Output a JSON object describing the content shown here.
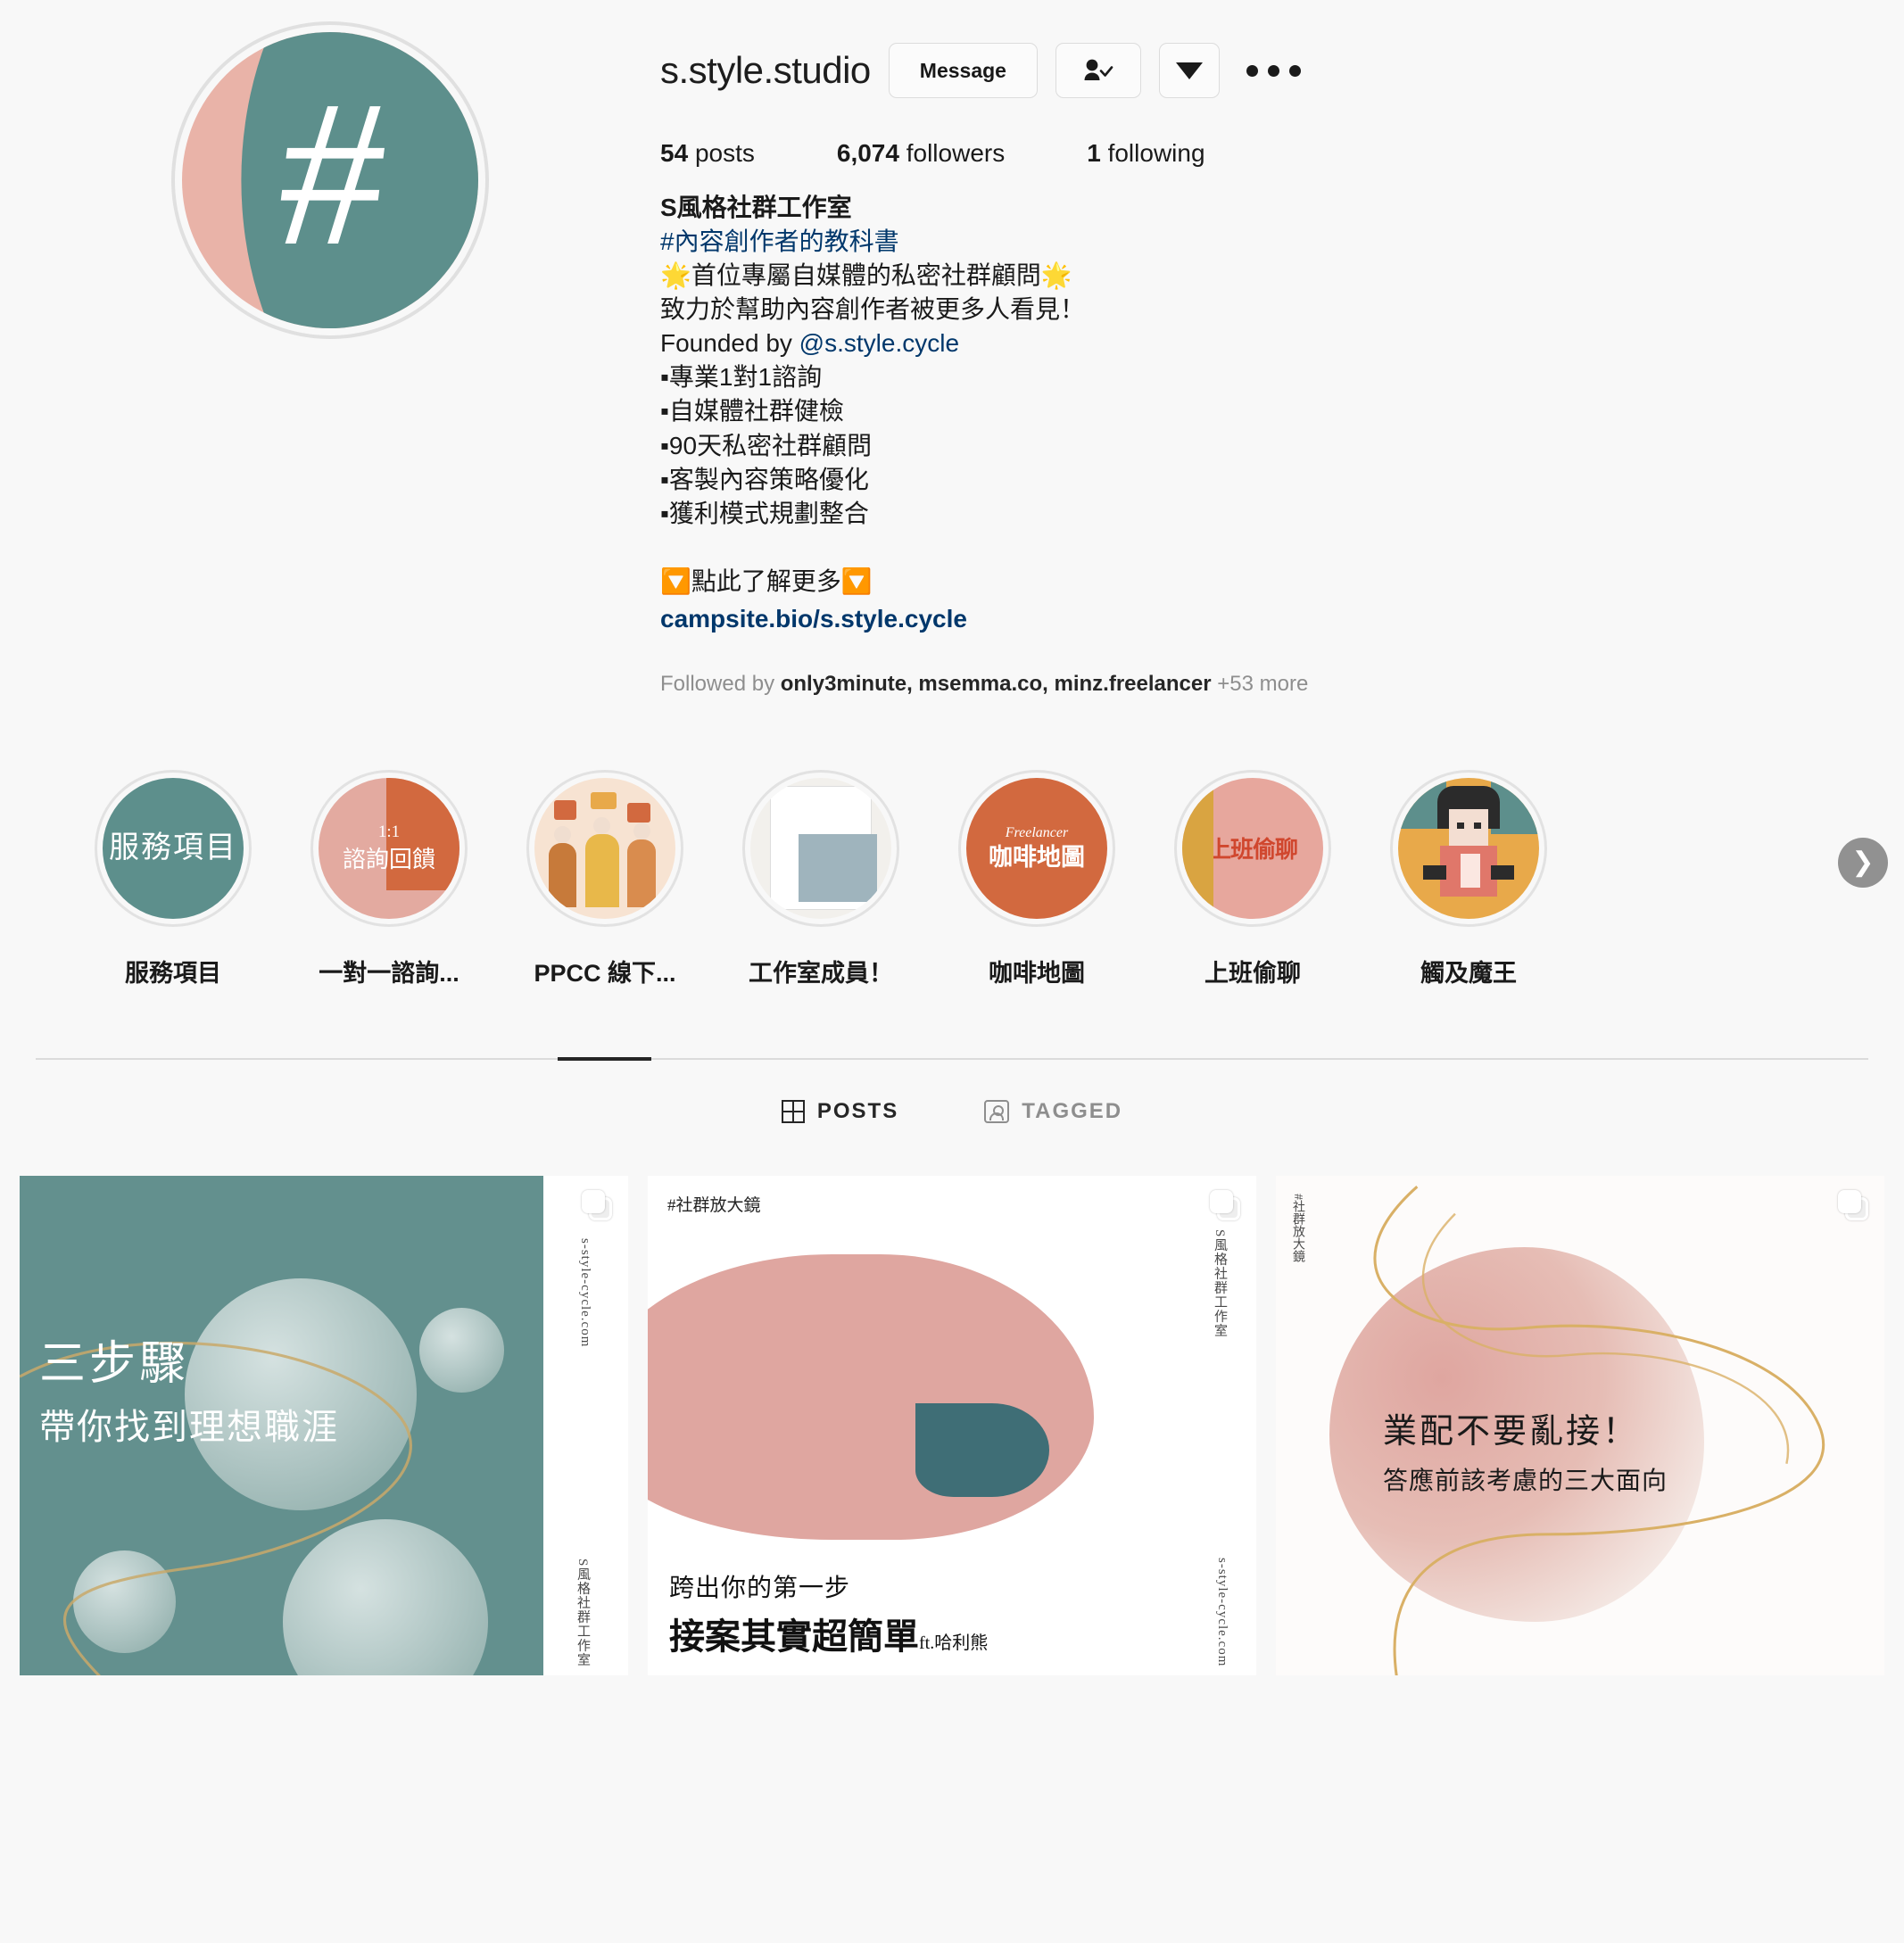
{
  "profile": {
    "username": "s.style.studio",
    "avatar_icon": "hashtag-logo",
    "buttons": {
      "message": "Message",
      "following_icon": "person-check-icon",
      "dropdown_icon": "caret-down-icon",
      "more_icon": "ellipsis-icon"
    },
    "stats": [
      {
        "value": "54",
        "label": "posts"
      },
      {
        "value": "6,074",
        "label": "followers"
      },
      {
        "value": "1",
        "label": "following"
      }
    ],
    "bio": {
      "display_name": "S風格社群工作室",
      "hashtag": "#內容創作者的教科書",
      "line_star": "🌟首位專屬自媒體的私密社群顧問🌟",
      "line_mission": "致力於幫助內容創作者被更多人看見！",
      "founded_prefix": "Founded by ",
      "founded_handle": "@s.style.cycle",
      "bullets": [
        "▪專業1對1諮詢",
        "▪自媒體社群健檢",
        "▪90天私密社群顧問",
        "▪客製內容策略優化",
        "▪獲利模式規劃整合"
      ],
      "cta": "🔽點此了解更多🔽",
      "link": "campsite.bio/s.style.cycle"
    },
    "followed_by": {
      "prefix": "Followed by ",
      "names": "only3minute, msemma.co, minz.freelancer",
      "suffix": " +53 more"
    }
  },
  "highlights": {
    "next_arrow_icon": "chevron-right-icon",
    "items": [
      {
        "label": "服務項目",
        "cover_text": "服務項目",
        "cover_class": "c1"
      },
      {
        "label": "一對一諮詢...",
        "cover_text": "諮詢回饋",
        "cover_sub": "1:1",
        "cover_class": "c2"
      },
      {
        "label": "PPCC 線下...",
        "cover_text": "",
        "cover_class": "c3"
      },
      {
        "label": "工作室成員！",
        "cover_text": "",
        "cover_class": "c4"
      },
      {
        "label": "咖啡地圖",
        "cover_text": "咖啡地圖",
        "cover_sub": "Freelancer",
        "cover_class": "c5"
      },
      {
        "label": "上班偷聊",
        "cover_text": "上班偷聊",
        "cover_class": "c6"
      },
      {
        "label": "觸及魔王",
        "cover_text": "",
        "cover_class": "c7"
      }
    ]
  },
  "tabs": [
    {
      "label": "POSTS",
      "icon": "grid-icon",
      "active": true
    },
    {
      "label": "TAGGED",
      "icon": "tagged-person-icon",
      "active": false
    }
  ],
  "posts": [
    {
      "title_line1": "三步驟",
      "title_line2": "帶你找到理想職涯",
      "side_url": "s-style-cycle.com",
      "side_brand": "S風格社群工作室",
      "carousel_icon": "carousel-icon"
    },
    {
      "hashtag": "#社群放大鏡",
      "caption_line1": "跨出你的第一步",
      "caption_highlight": "接案",
      "caption_rest": "其實超簡單",
      "caption_credit": "ft.哈利熊",
      "side_brand": "S風格社群工作室",
      "side_url": "s-style-cycle.com",
      "carousel_icon": "carousel-icon"
    },
    {
      "hashtag": "#社群放大鏡",
      "title_line1": "業配不要亂接！",
      "title_line2": "答應前該考慮的三大面向",
      "carousel_icon": "carousel-icon"
    }
  ],
  "colors": {
    "teal": "#5d8f8c",
    "pink": "#e9b3a8",
    "orange": "#d2693f",
    "link_blue": "#00376b",
    "muted": "#8e8e8e",
    "gold": "#d9b066"
  }
}
